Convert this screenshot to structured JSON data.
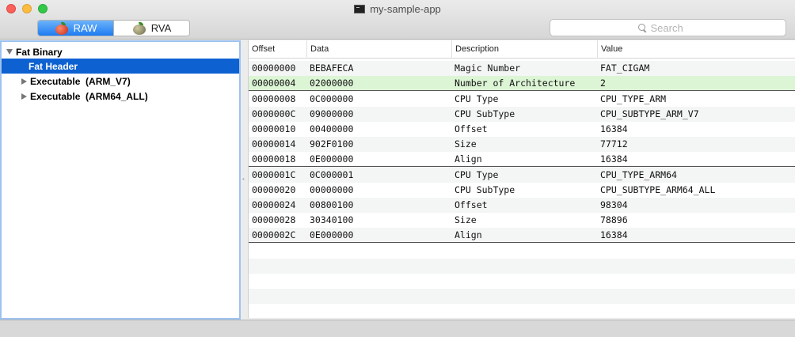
{
  "window": {
    "title": "my-sample-app"
  },
  "toolbar": {
    "raw_label": "RAW",
    "rva_label": "RVA",
    "search_placeholder": "Search"
  },
  "outline": {
    "root_label": "Fat Binary",
    "items": [
      {
        "label": "Fat Header",
        "selected": true
      },
      {
        "label": "Executable  (ARM_V7)"
      },
      {
        "label": "Executable  (ARM64_ALL)"
      }
    ]
  },
  "table": {
    "headers": {
      "offset": "Offset",
      "data": "Data",
      "description": "Description",
      "value": "Value"
    },
    "rows": [
      {
        "offset": "00000000",
        "data": "BEBAFECA",
        "description": "Magic Number",
        "value": "FAT_CIGAM"
      },
      {
        "offset": "00000004",
        "data": "02000000",
        "description": "Number of Architecture",
        "value": "2"
      },
      {
        "offset": "00000008",
        "data": "0C000000",
        "description": "CPU Type",
        "value": "CPU_TYPE_ARM"
      },
      {
        "offset": "0000000C",
        "data": "09000000",
        "description": "CPU SubType",
        "value": "CPU_SUBTYPE_ARM_V7"
      },
      {
        "offset": "00000010",
        "data": "00400000",
        "description": "Offset",
        "value": "16384"
      },
      {
        "offset": "00000014",
        "data": "902F0100",
        "description": "Size",
        "value": "77712"
      },
      {
        "offset": "00000018",
        "data": "0E000000",
        "description": "Align",
        "value": "16384"
      },
      {
        "offset": "0000001C",
        "data": "0C000001",
        "description": "CPU Type",
        "value": "CPU_TYPE_ARM64"
      },
      {
        "offset": "00000020",
        "data": "00000000",
        "description": "CPU SubType",
        "value": "CPU_SUBTYPE_ARM64_ALL"
      },
      {
        "offset": "00000024",
        "data": "00800100",
        "description": "Offset",
        "value": "98304"
      },
      {
        "offset": "00000028",
        "data": "30340100",
        "description": "Size",
        "value": "78896"
      },
      {
        "offset": "0000002C",
        "data": "0E000000",
        "description": "Align",
        "value": "16384"
      }
    ]
  },
  "colors": {
    "selection": "#0d61d1",
    "highlight_row": "#dcf5d5",
    "segment_active": "#1d7cf2"
  }
}
